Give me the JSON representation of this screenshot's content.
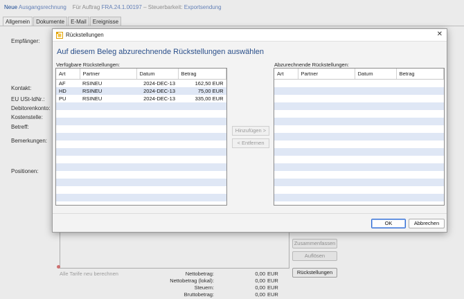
{
  "background": {
    "title": {
      "neue": "Neue",
      "doc_type": "Ausgangsrechnung",
      "order_label": "Für Auftrag",
      "order_no": "FRA.24.1.00197",
      "dash": "–",
      "tax_label": "Steuerbarkeit:",
      "tax_value": "Exportsendung"
    },
    "tabs": [
      "Allgemein",
      "Dokumente",
      "E-Mail",
      "Ereignisse"
    ],
    "labels": {
      "empfaenger": "Empfänger:",
      "kontakt": "Kontakt:",
      "ust": "EU USt-IdNr.:",
      "debitorenkonto": "Debitorenkonto:",
      "kostenstelle": "Kostenstelle:",
      "betreff": "Betreff:",
      "bemerkungen": "Bemerkungen:",
      "positionen": "Positionen:"
    },
    "buttons": {
      "zusammenfassen": "Zusammenfassen",
      "aufloesen": "Auflösen",
      "rueckstellungen": "Rückstellungen"
    },
    "alle_tarife": "Alle Tarife neu berechnen",
    "totals": [
      {
        "label": "Nettobetrag:",
        "value": "0,00",
        "currency": "EUR"
      },
      {
        "label": "Nettobetrag (lokal):",
        "value": "0,00",
        "currency": "EUR"
      },
      {
        "label": "Steuern:",
        "value": "0,00",
        "currency": "EUR"
      },
      {
        "label": "Bruttobetrag:",
        "value": "0,00",
        "currency": "EUR"
      }
    ]
  },
  "dialog": {
    "title": "Rückstellungen",
    "heading": "Auf diesem Beleg abzurechnende Rückstellungen auswählen",
    "available_caption": "Verfügbare Rückstellungen:",
    "selected_caption": "Abzurechnende Rückstellungen:",
    "columns": [
      "Art",
      "Partner",
      "Datum",
      "Betrag"
    ],
    "available_rows": [
      {
        "art": "AF",
        "partner": "RSINEU",
        "datum": "2024-DEC-13",
        "betrag": "162,50 EUR"
      },
      {
        "art": "HD",
        "partner": "RSINEU",
        "datum": "2024-DEC-13",
        "betrag": "75,00 EUR"
      },
      {
        "art": "PU",
        "partner": "RSINEU",
        "datum": "2024-DEC-13",
        "betrag": "335,00 EUR"
      }
    ],
    "add_button": "Hinzufügen >",
    "remove_button": "< Entfernen",
    "ok_button": "OK",
    "cancel_button": "Abbrechen",
    "close_icon": "close-icon",
    "app_icon": "rueckstellungen-icon"
  },
  "colors": {
    "heading": "#2a4f8a",
    "row_alt": "#dfe7f5",
    "ok_border": "#2f6bd3"
  }
}
